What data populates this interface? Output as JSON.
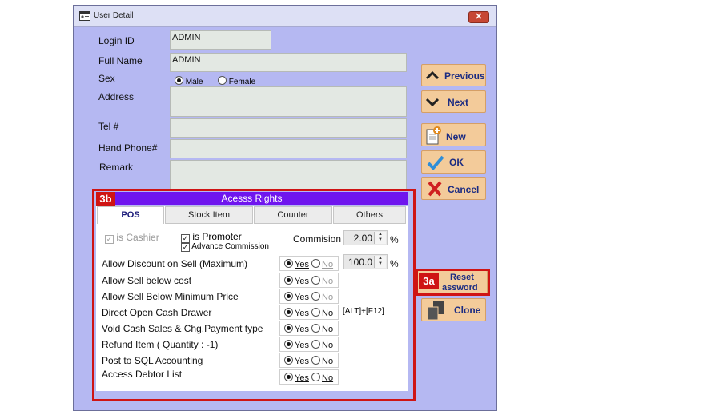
{
  "window": {
    "title": "User Detail",
    "close": "✕"
  },
  "form": {
    "login_id_label": "Login ID",
    "login_id_value": "ADMIN",
    "full_name_label": "Full Name",
    "full_name_value": "ADMIN",
    "sex_label": "Sex",
    "sex_male": "Male",
    "sex_female": "Female",
    "sex_selected": "Male",
    "address_label": "Address",
    "tel_label": "Tel #",
    "hand_phone_label": "Hand Phone#",
    "remark_label": "Remark"
  },
  "buttons": {
    "previous": "Previous",
    "next": "Next",
    "new": "New",
    "ok": "OK",
    "cancel": "Cancel",
    "reset_line1": "Reset",
    "reset_line2": "assword",
    "clone": "Clone"
  },
  "callouts": {
    "a": "3a",
    "b": "3b"
  },
  "access_rights": {
    "title": "Acesss Rights",
    "tabs": [
      "POS",
      "Stock Item",
      "Counter",
      "Others"
    ],
    "active_tab": "POS",
    "is_cashier": "is Cashier",
    "is_promoter": "is Promoter",
    "advance_commission": "Advance Commission",
    "commission_label": "Commision",
    "commission_value": "2.00",
    "percent": "%",
    "discount_value": "100.0",
    "hotkey": "[ALT]+[F12]",
    "yes": "Yes",
    "no": "No",
    "rights": [
      "Allow Discount on Sell (Maximum)",
      "Allow Sell below cost",
      "Allow Sell Below Minimum Price",
      "Direct Open Cash Drawer",
      "Void Cash Sales & Chg.Payment type",
      "Refund Item ( Quantity :   -1)",
      "Post to SQL Accounting",
      "Access Debtor List"
    ]
  },
  "colors": {
    "window_bg": "#b5b8f2",
    "button_bg": "#f3cb9a",
    "button_text": "#1c2c82",
    "header_purple": "#6f15ee",
    "callout_red": "#cf1414"
  }
}
